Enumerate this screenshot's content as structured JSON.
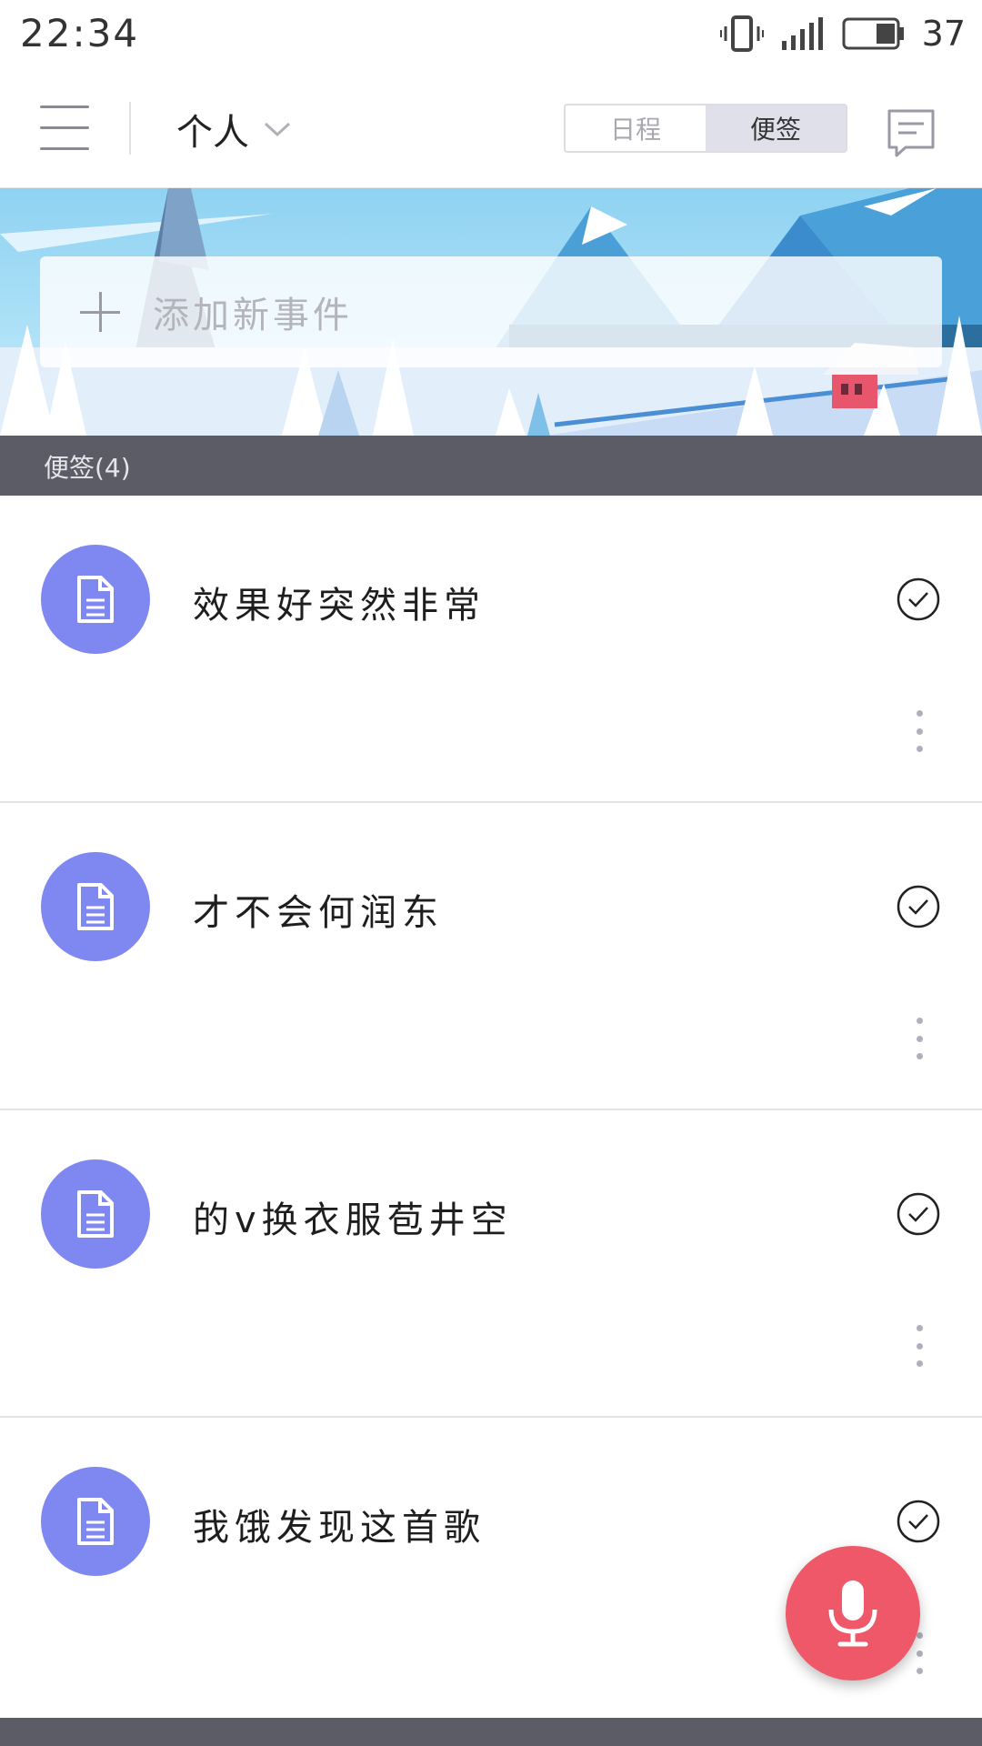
{
  "status_bar": {
    "time": "22:34",
    "battery_percent": "37",
    "icons": [
      "vibrate-icon",
      "signal-icon",
      "battery-icon"
    ]
  },
  "header": {
    "menu_icon": "hamburger-menu-icon",
    "account_label": "个人",
    "account_dropdown_icon": "chevron-down-icon",
    "tabs": [
      {
        "label": "日程",
        "active": false
      },
      {
        "label": "便签",
        "active": true
      }
    ],
    "message_icon": "message-icon"
  },
  "add_event": {
    "placeholder": "添加新事件",
    "icon": "plus-icon"
  },
  "section": {
    "title": "便签(4)"
  },
  "notes": [
    {
      "title": "效果好突然非常",
      "icon": "document-icon"
    },
    {
      "title": "才不会何润东",
      "icon": "document-icon"
    },
    {
      "title": "的v换衣服苞井空",
      "icon": "document-icon"
    },
    {
      "title": "我饿发现这首歌",
      "icon": "document-icon"
    }
  ],
  "fab": {
    "icon": "microphone-icon"
  },
  "colors": {
    "avatar": "#7f88f1",
    "fab": "#ee5868",
    "section_bg": "#5c5c66",
    "tab_active_bg": "#e0e0ea"
  }
}
